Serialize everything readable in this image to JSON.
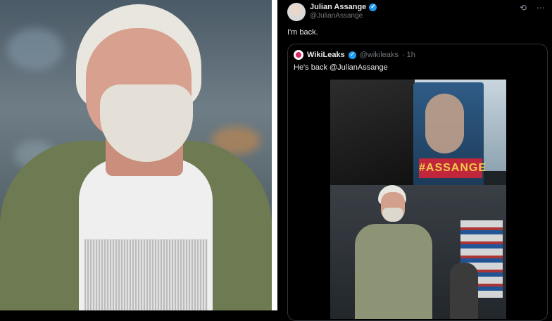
{
  "tweet": {
    "author_name": "Julian Assange",
    "author_handle": "@JulianAssange",
    "text": "I'm back.",
    "quoted": {
      "author_name": "WikiLeaks",
      "author_handle": "@wikileaks",
      "time": "· 1h",
      "text": "He's back @JulianAssange",
      "image_sign_text": "#ASSANGE"
    }
  },
  "icons": {
    "refresh": "grok-icon",
    "more": "more-icon"
  },
  "colors": {
    "verified": "#1d9bf0",
    "background": "#000000",
    "primary_text": "#e7e9ea",
    "secondary_text": "#71767b"
  }
}
